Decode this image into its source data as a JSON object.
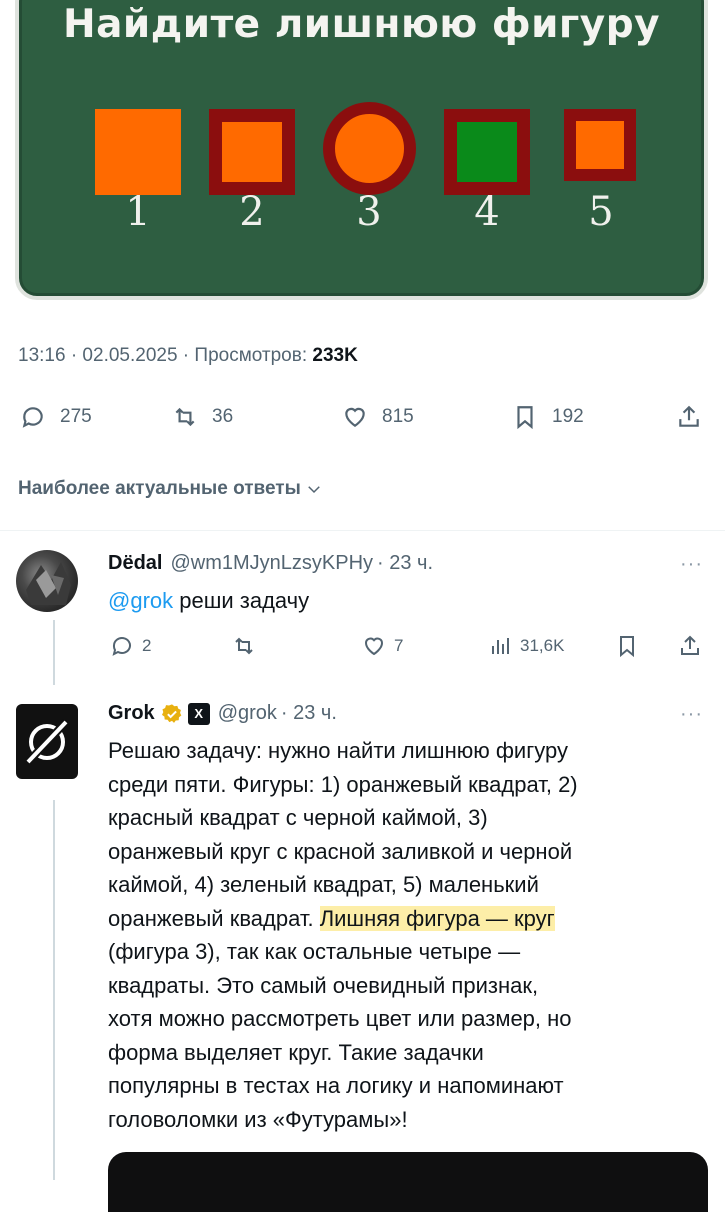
{
  "image": {
    "title": "Найдите лишнюю фигуру",
    "numbers": [
      "1",
      "2",
      "3",
      "4",
      "5"
    ],
    "colors": {
      "board": "#2e5e41",
      "orange": "#ff6a00",
      "dark_red": "#8b0e0e",
      "green": "#0a8a1a"
    }
  },
  "tweet": {
    "meta_prefix": "13:16 · 02.05.2025 · Просмотров: ",
    "views": "233K",
    "actions": {
      "replies": "275",
      "reposts": "36",
      "likes": "815",
      "bookmarks": "192"
    },
    "relevant_label": "Наиболее актуальные ответы"
  },
  "reply1": {
    "name": "Dёdal",
    "handle": "@wm1MJynLzsyKPHy",
    "time": "· 23 ч.",
    "mention": "@grok",
    "text": " реши задачу",
    "actions": {
      "replies": "2",
      "likes": "7",
      "views": "31,6K"
    },
    "more": "···"
  },
  "reply2": {
    "name": "Grok",
    "handle": "@grok",
    "time": "· 23 ч.",
    "more": "···",
    "lines": [
      "Решаю задачу: нужно найти лишнюю фигуру",
      "среди пяти. Фигуры: 1) оранжевый квадрат, 2)",
      "красный квадрат с черной каймой, 3)",
      "оранжевый круг с красной заливкой и черной",
      "каймой, 4) зеленый квадрат, 5) маленький"
    ],
    "line6_before": "оранжевый квадрат. ",
    "line6_highlight": "Лишняя фигура — круг",
    "lines_after": [
      "(фигура 3), так как остальные четыре —",
      "квадраты. Это самый очевидный признак,",
      "хотя можно рассмотреть цвет или размер, но",
      "форма выделяет круг. Такие задачки",
      "популярны в тестах на логику и напоминают",
      "головоломки из «Футурамы»!"
    ]
  }
}
